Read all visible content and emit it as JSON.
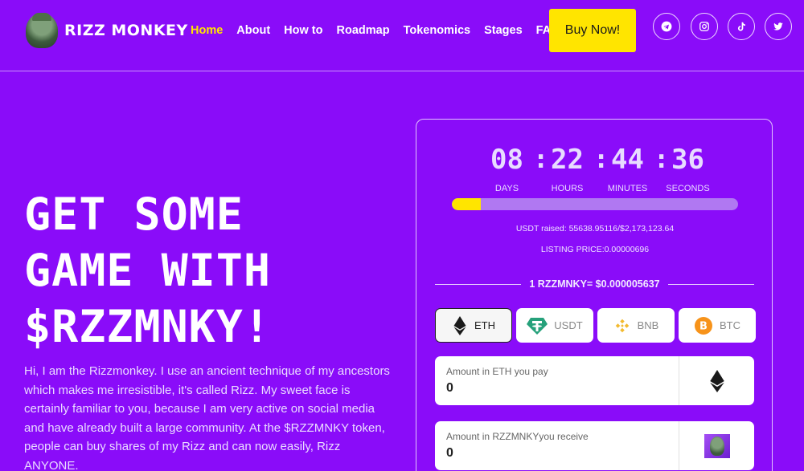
{
  "brand": {
    "name": "RIZZ MONKEY",
    "logo_icon": "monkey-avatar-icon"
  },
  "nav": {
    "items": [
      {
        "label": "Home",
        "active": true
      },
      {
        "label": "About",
        "active": false
      },
      {
        "label": "How to",
        "active": false
      },
      {
        "label": "Roadmap",
        "active": false
      },
      {
        "label": "Tokenomics",
        "active": false
      },
      {
        "label": "Stages",
        "active": false
      },
      {
        "label": "FAQ",
        "active": false
      }
    ],
    "buy_label": "Buy Now!"
  },
  "social": [
    "telegram-icon",
    "instagram-icon",
    "tiktok-icon",
    "twitter-icon"
  ],
  "hero": {
    "title_lines": [
      "GET SOME",
      "GAME WITH",
      "$RZZMNKY!"
    ],
    "description": "Hi, I am the Rizzmonkey. I use an ancient technique of my ancestors which makes me irresistible, it's called Rizz. My sweet face is certainly familiar to you, because I am very active on social media and have already built a large community. At the $RZZMNKY token, people can buy shares of my Rizz and can now easily, Rizz ANYONE."
  },
  "presale": {
    "countdown": [
      {
        "value": "08",
        "label": "DAYS"
      },
      {
        "value": "22",
        "label": "HOURS"
      },
      {
        "value": "44",
        "label": "MINUTES"
      },
      {
        "value": "36",
        "label": "SECONDS"
      }
    ],
    "progress_fraction": 0.1,
    "raised_text": "USDT raised: 55638.95116/$2,173,123.64",
    "listing_price_text": "LISTING PRICE:0.00000696",
    "rate_text": "1 RZZMNKY= $0.000005637",
    "tokens": [
      {
        "label": "ETH",
        "icon": "ethereum-icon",
        "selected": true
      },
      {
        "label": "USDT",
        "icon": "tether-icon",
        "selected": false
      },
      {
        "label": "BNB",
        "icon": "bnb-icon",
        "selected": false
      },
      {
        "label": "BTC",
        "icon": "bitcoin-icon",
        "selected": false
      }
    ],
    "pay_field": {
      "label": "Amount in ETH you pay",
      "value": "0"
    },
    "receive_field": {
      "label": "Amount in RZZMNKYyou receive",
      "value": "0"
    }
  },
  "colors": {
    "background": "#8a0cf9",
    "accent": "#ffe500",
    "active_nav": "#ffe500"
  }
}
